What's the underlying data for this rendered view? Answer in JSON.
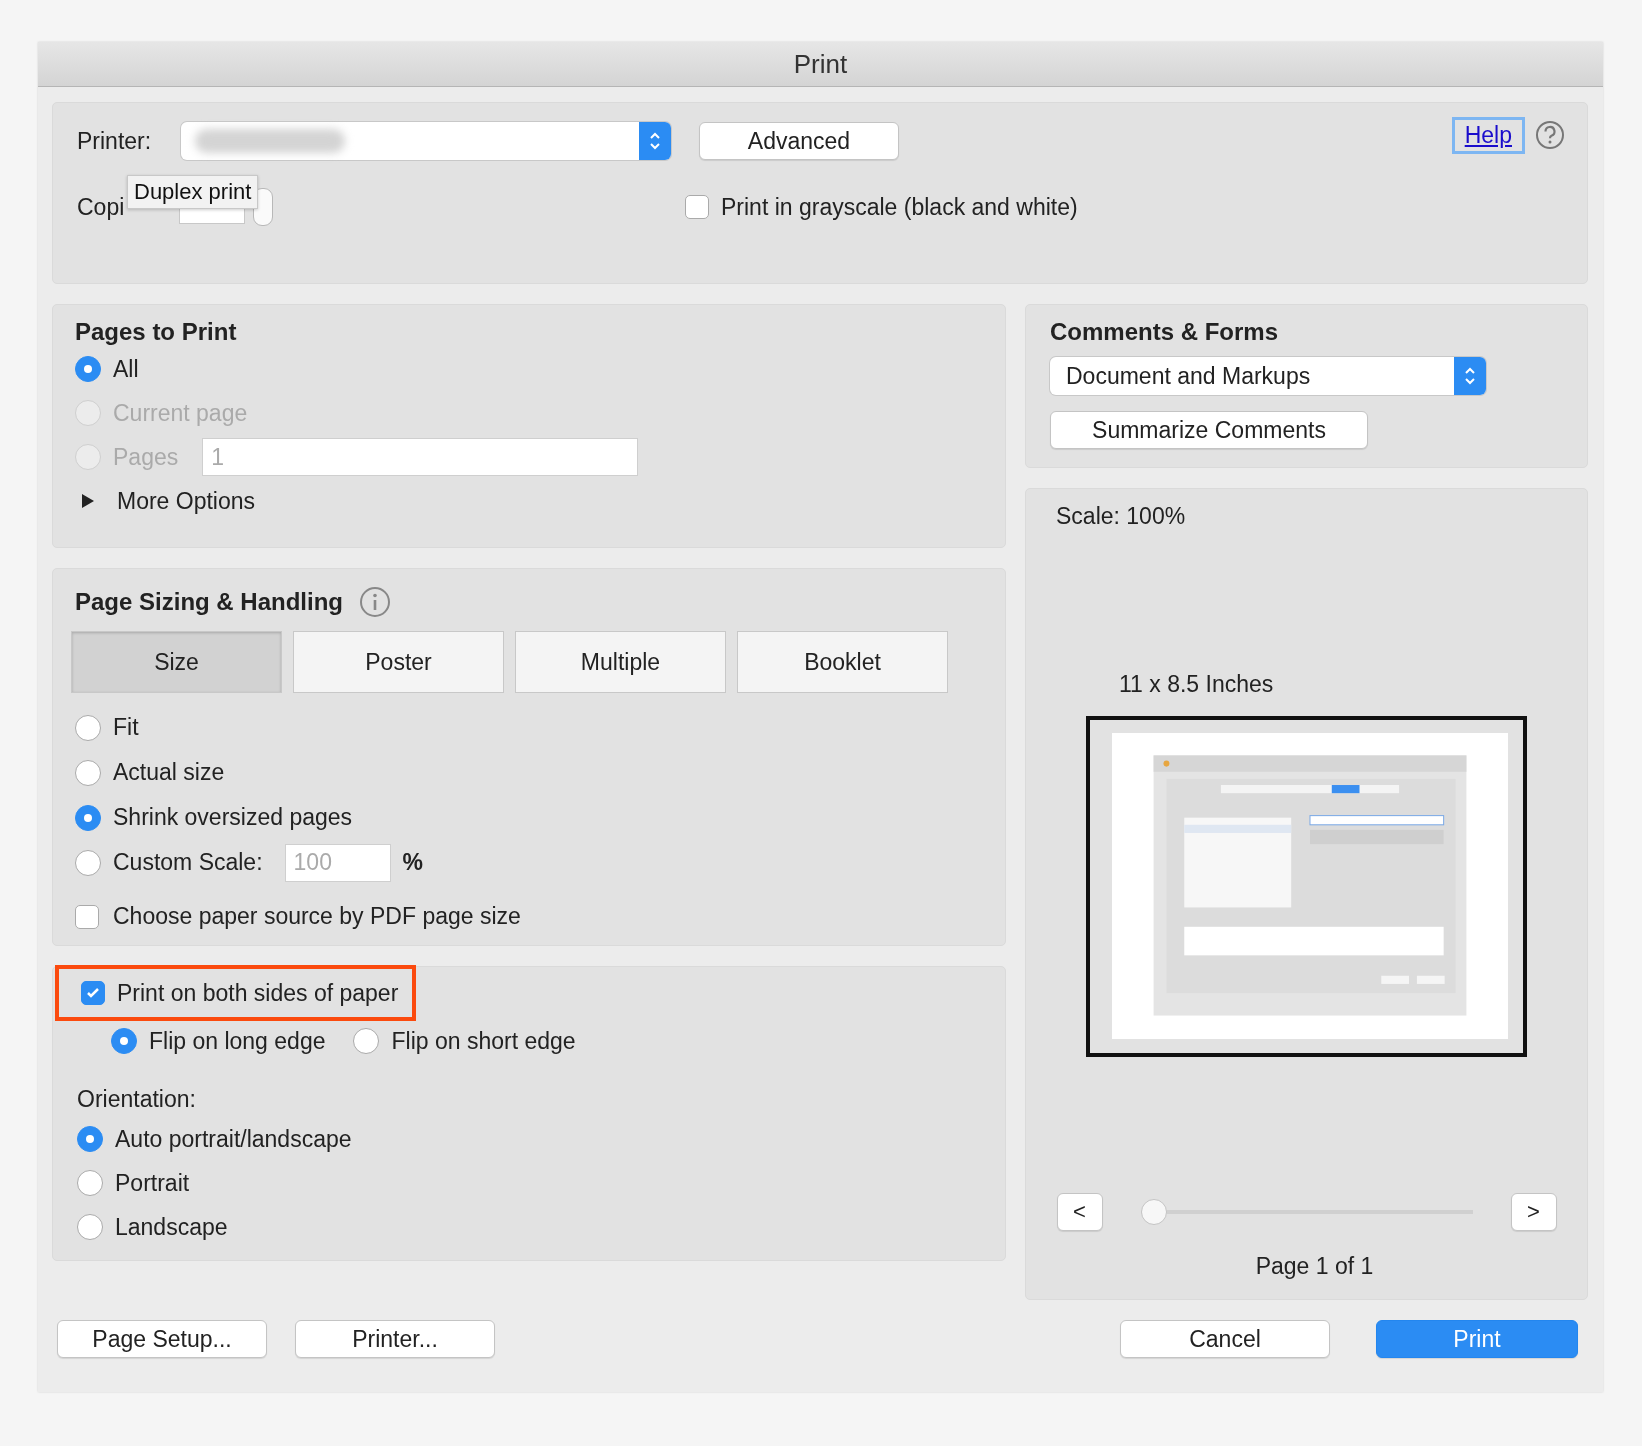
{
  "window": {
    "title": "Print"
  },
  "printer": {
    "label": "Printer:",
    "advanced_button": "Advanced",
    "help_link": "Help"
  },
  "copies": {
    "label": "Copi"
  },
  "tooltip": "Duplex print",
  "grayscale": {
    "label": "Print in grayscale (black and white)",
    "checked": false
  },
  "pages_to_print": {
    "title": "Pages to Print",
    "options": [
      {
        "label": "All",
        "selected": true,
        "disabled": false
      },
      {
        "label": "Current page",
        "selected": false,
        "disabled": true
      },
      {
        "label": "Pages",
        "selected": false,
        "disabled": true,
        "kind": "range",
        "value": "1"
      }
    ],
    "more_options": {
      "label": "More Options",
      "expanded": false
    }
  },
  "page_sizing": {
    "title": "Page Sizing & Handling",
    "tabs": [
      {
        "label": "Size",
        "selected": true
      },
      {
        "label": "Poster",
        "selected": false
      },
      {
        "label": "Multiple",
        "selected": false
      },
      {
        "label": "Booklet",
        "selected": false
      }
    ],
    "options": [
      {
        "label": "Fit",
        "selected": false
      },
      {
        "label": "Actual size",
        "selected": false
      },
      {
        "label": "Shrink oversized pages",
        "selected": true
      },
      {
        "label": "Custom Scale:",
        "selected": false,
        "kind": "custom",
        "value": "100",
        "unit": "%"
      }
    ],
    "paper_source": {
      "label": "Choose paper source by PDF page size",
      "checked": false
    }
  },
  "duplex": {
    "label": "Print on both sides of paper",
    "checked": true,
    "highlighted": true,
    "flip": [
      {
        "label": "Flip on long edge",
        "selected": true
      },
      {
        "label": "Flip on short edge",
        "selected": false
      }
    ]
  },
  "orientation": {
    "label": "Orientation:",
    "options": [
      {
        "label": "Auto portrait/landscape",
        "selected": true
      },
      {
        "label": "Portrait",
        "selected": false
      },
      {
        "label": "Landscape",
        "selected": false
      }
    ]
  },
  "comments_forms": {
    "title": "Comments & Forms",
    "dropdown": "Document and Markups",
    "summarize_button": "Summarize Comments"
  },
  "preview": {
    "scale": "Scale: 100%",
    "paper_size": "11 x 8.5 Inches",
    "prev_button": "<",
    "next_button": ">",
    "slider": {
      "level": 0
    },
    "page_label": "Page 1 of 1"
  },
  "buttons": {
    "page_setup": "Page Setup...",
    "printer": "Printer...",
    "cancel": "Cancel",
    "print": "Print"
  }
}
